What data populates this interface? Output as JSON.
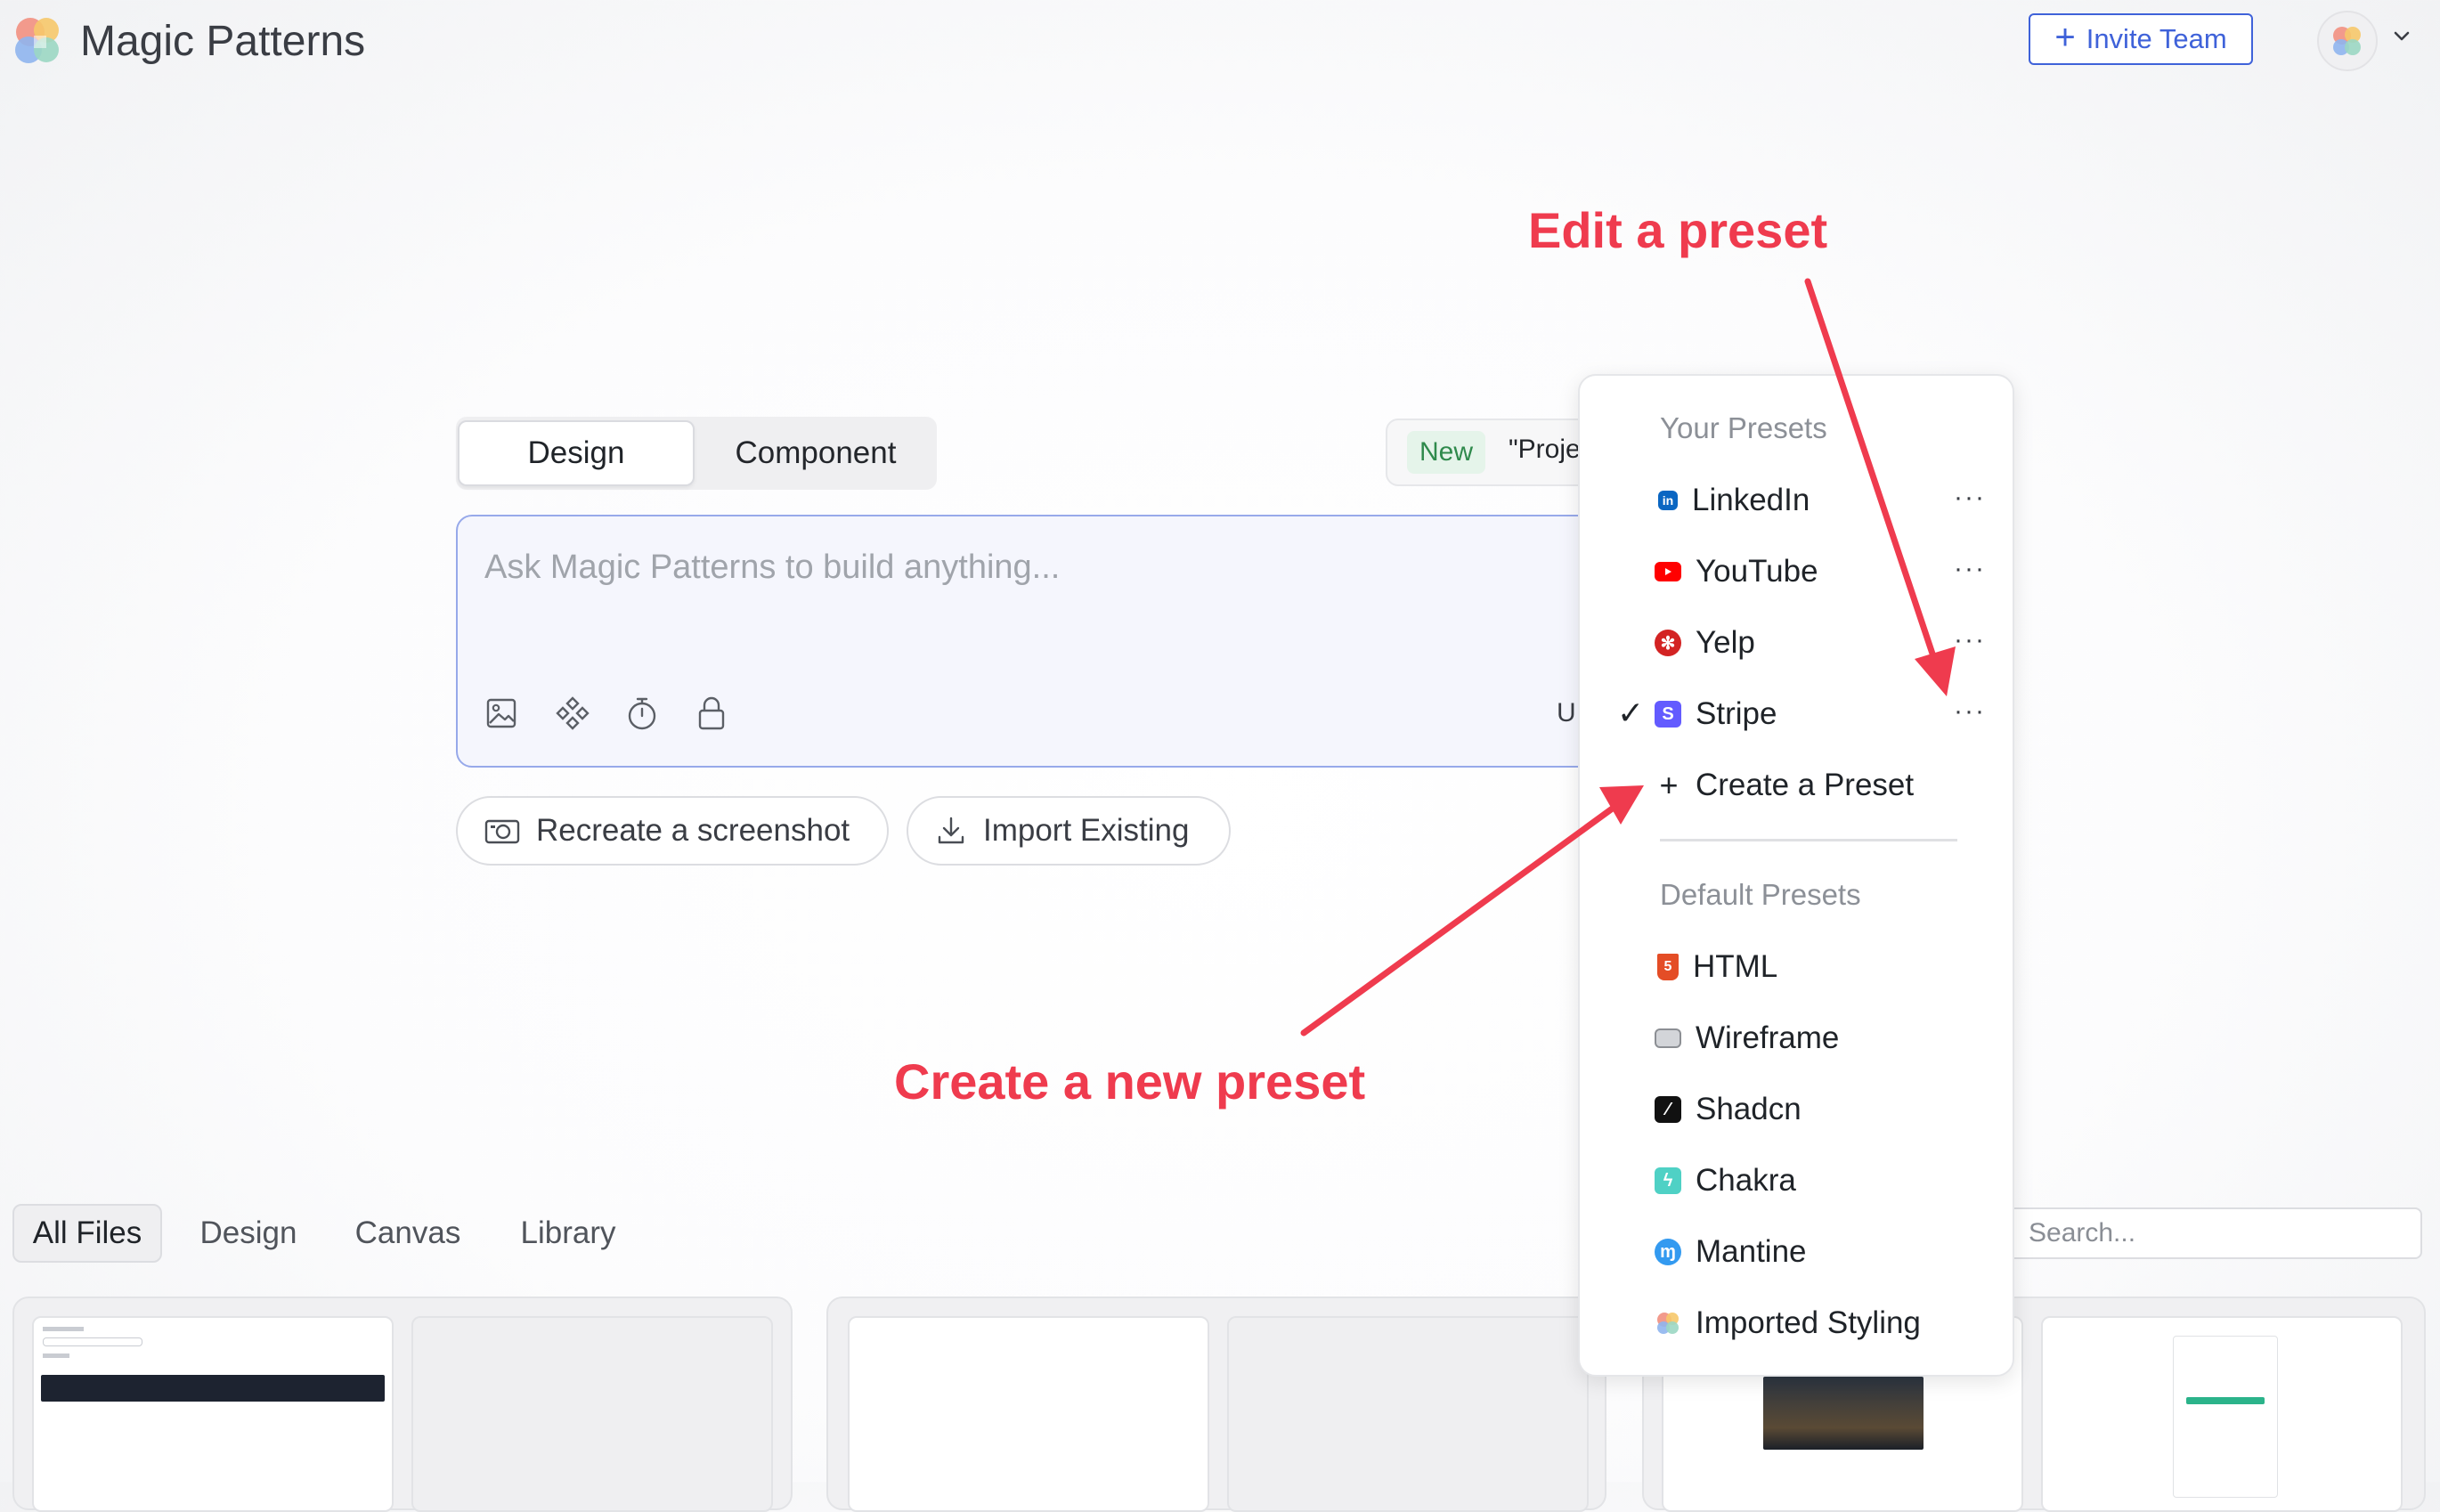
{
  "header": {
    "app_title": "Magic Patterns",
    "invite_label": "Invite Team"
  },
  "composer": {
    "tabs": [
      "Design",
      "Component"
    ],
    "new_badge": "New",
    "project_text": "\"Proje",
    "placeholder": "Ask Magic Patterns to build anything...",
    "cutoff_letter": "U",
    "actions": [
      "Recreate a screenshot",
      "Import Existing"
    ]
  },
  "annotations": {
    "edit": "Edit a preset",
    "create": "Create a new preset"
  },
  "files": {
    "tabs": [
      "All Files",
      "Design",
      "Canvas",
      "Library"
    ],
    "search_placeholder": "Search..."
  },
  "presets": {
    "your_header": "Your Presets",
    "your": [
      {
        "label": "LinkedIn",
        "icon": "linkedin-icon",
        "color": "#0a66c2"
      },
      {
        "label": "YouTube",
        "icon": "youtube-icon",
        "color": "#ff0000"
      },
      {
        "label": "Yelp",
        "icon": "yelp-icon",
        "color": "#d32323"
      },
      {
        "label": "Stripe",
        "icon": "stripe-icon",
        "color": "#635bff",
        "selected": true
      }
    ],
    "more_label": "···",
    "create_label": "Create a Preset",
    "default_header": "Default Presets",
    "defaults": [
      {
        "label": "HTML",
        "icon": "html5-icon",
        "color": "#e44d26"
      },
      {
        "label": "Wireframe",
        "icon": "wireframe-icon",
        "color": "#8c8f94"
      },
      {
        "label": "Shadcn",
        "icon": "shadcn-icon",
        "color": "#111111"
      },
      {
        "label": "Chakra",
        "icon": "chakra-icon",
        "color": "#4fd1c5"
      },
      {
        "label": "Mantine",
        "icon": "mantine-icon",
        "color": "#339af0"
      },
      {
        "label": "Imported Styling",
        "icon": "magic-patterns-icon",
        "color": "#f08a7e"
      }
    ]
  },
  "colors": {
    "accent": "#3f62d9",
    "annotation": "#ef3b4e",
    "new_badge_bg": "#e5f4ea",
    "new_badge_text": "#2f8a4c"
  }
}
